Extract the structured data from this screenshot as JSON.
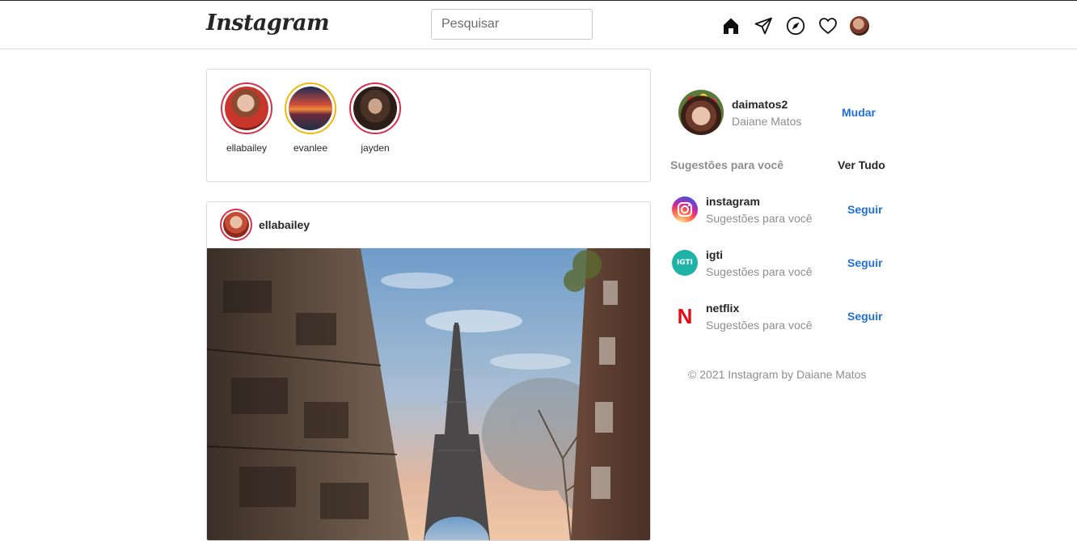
{
  "header": {
    "logo": "Instagram",
    "search_placeholder": "Pesquisar",
    "icons": [
      "home-icon",
      "direct-send-icon",
      "explore-compass-icon",
      "heart-icon",
      "profile-avatar"
    ]
  },
  "stories": [
    {
      "username": "ellabailey",
      "ring_color": "#d6304a"
    },
    {
      "username": "evanlee",
      "ring_color": "#f2b70c"
    },
    {
      "username": "jayden",
      "ring_color": "#d6304a"
    }
  ],
  "post": {
    "username": "ellabailey"
  },
  "sidebar": {
    "username": "daimatos2",
    "fullname": "Daiane Matos",
    "switch_label": "Mudar",
    "suggestions_title": "Sugestões para você",
    "see_all_label": "Ver Tudo",
    "suggestions": [
      {
        "name": "instagram",
        "subtitle": "Sugestões para você",
        "follow_label": "Seguir"
      },
      {
        "name": "igti",
        "subtitle": "Sugestões para você",
        "follow_label": "Seguir",
        "icon_text": "IGTI"
      },
      {
        "name": "netflix",
        "subtitle": "Sugestões para você",
        "follow_label": "Seguir",
        "icon_text": "N"
      }
    ],
    "footer": "© 2021 Instagram by Daiane Matos"
  },
  "colors": {
    "accent_blue": "#1f6fd6",
    "story_ring_red": "#d6304a",
    "story_ring_gold": "#f2b70c",
    "border": "#dbdbdb",
    "muted_text": "#8e8e8e"
  }
}
